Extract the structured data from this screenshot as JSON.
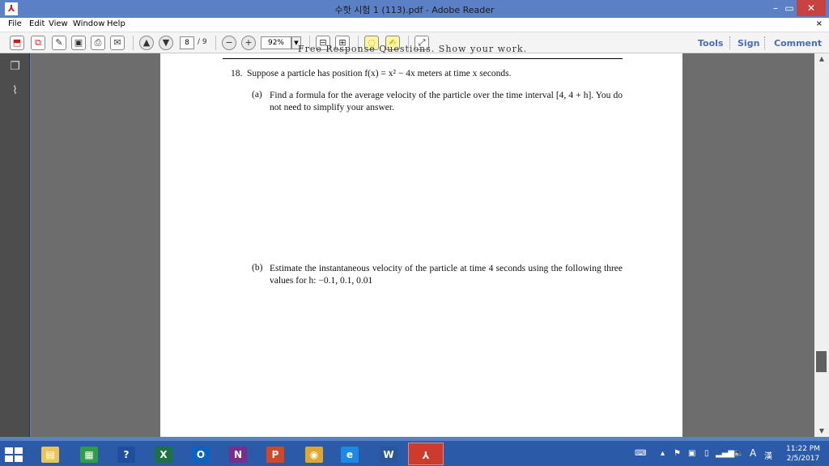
{
  "window": {
    "title": "수핫 시험 1 (113).pdf - Adobe Reader",
    "logo_glyph": "⅄",
    "minimize_glyph": "–",
    "restore_glyph": "▭",
    "close_glyph": "✕"
  },
  "menu": {
    "items": [
      "File",
      "Edit",
      "View",
      "Window",
      "Help"
    ],
    "close_glyph": "×"
  },
  "toolbar": {
    "page_current": "8",
    "page_total": "/ 9",
    "zoom": "92%",
    "links": [
      "Tools",
      "Sign",
      "Comment"
    ],
    "icons": [
      "create-pdf-icon",
      "combine-icon",
      "edit-icon",
      "save-icon",
      "print-icon",
      "email-icon",
      "page-up-icon",
      "page-down-icon",
      "zoom-out-icon",
      "zoom-in-icon",
      "fit-page-icon",
      "full-screen-icon",
      "comment-icon",
      "sign-pen-icon",
      "expand-icon"
    ],
    "accent": "#4b6db0"
  },
  "document": {
    "header_clipped": "Free Response Questions. Show your work.",
    "question_number": "18.",
    "question_text": "Suppose a particle has position f(x) = x² − 4x meters at time x seconds.",
    "parts": [
      {
        "label": "(a)",
        "text": "Find a formula for the average velocity of the particle over the time interval [4, 4 + h]. You do not need to simplify your answer."
      },
      {
        "label": "(b)",
        "text": "Estimate the instantaneous velocity of the particle at time 4 seconds using the following three values for h: −0.1, 0.1, 0.01"
      }
    ]
  },
  "taskbar": {
    "apps": [
      {
        "name": "file-explorer",
        "glyph": "▤",
        "color": "#e8c45a"
      },
      {
        "name": "store",
        "glyph": "▦",
        "color": "#2f9e44"
      },
      {
        "name": "help",
        "glyph": "?",
        "color": "#1f4f9e"
      },
      {
        "name": "excel",
        "glyph": "X",
        "color": "#1e7145"
      },
      {
        "name": "outlook",
        "glyph": "O",
        "color": "#0b64c0"
      },
      {
        "name": "onenote",
        "glyph": "N",
        "color": "#7a2d8a"
      },
      {
        "name": "powerpoint",
        "glyph": "P",
        "color": "#d24726"
      },
      {
        "name": "chrome",
        "glyph": "◉",
        "color": "#e0a82e"
      },
      {
        "name": "internet-explorer",
        "glyph": "e",
        "color": "#1e88e5"
      },
      {
        "name": "word",
        "glyph": "W",
        "color": "#2b579a"
      },
      {
        "name": "adobe-reader",
        "glyph": "⅄",
        "color": "#cd3a2e"
      }
    ],
    "tray_language": "A",
    "tray_ime": "漢",
    "time": "11:22 PM",
    "date": "2/5/2017"
  }
}
